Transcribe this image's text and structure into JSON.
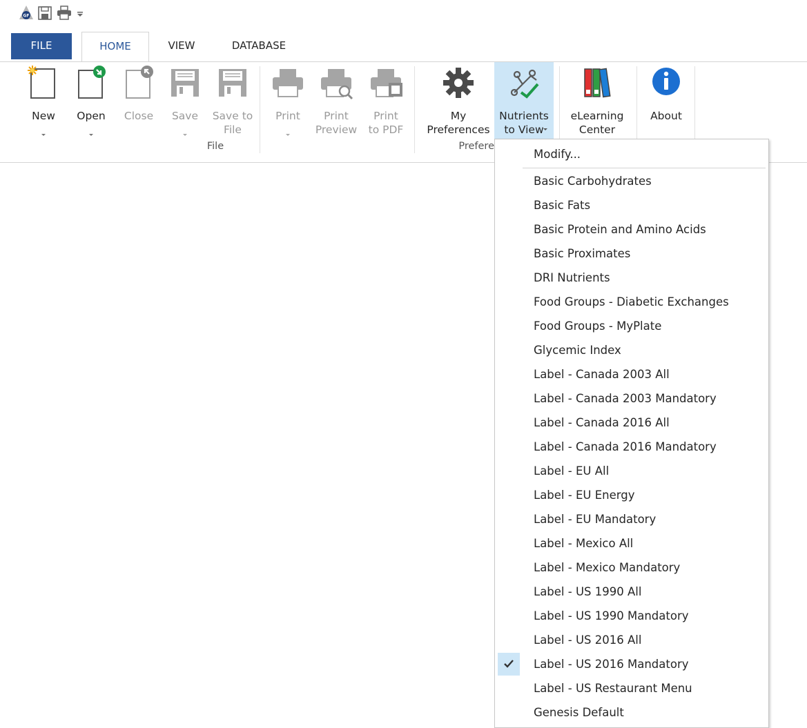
{
  "colors": {
    "accent": "#2b579a",
    "hover_highlight": "#cde6f7",
    "disabled_text": "#9a9a9a"
  },
  "quick_access": {
    "icons": [
      "genesis-logo-icon",
      "save-icon",
      "print-icon",
      "customize-dropdown-icon"
    ],
    "logo_text": "GF"
  },
  "tabs": [
    {
      "label": "FILE"
    },
    {
      "label": "HOME"
    },
    {
      "label": "VIEW"
    },
    {
      "label": "DATABASE"
    }
  ],
  "ribbon": {
    "file_group": {
      "label": "File",
      "buttons": {
        "new": "New",
        "open": "Open",
        "close": "Close",
        "save": "Save",
        "save_to_file": "Save to\nFile",
        "print": "Print",
        "print_preview": "Print\nPreview",
        "print_pdf": "Print\nto PDF"
      }
    },
    "preferences_group": {
      "label": "Prefere",
      "buttons": {
        "my_preferences": "My\nPreferences",
        "nutrients_to_view": "Nutrients\nto View"
      }
    },
    "other_buttons": {
      "elearning": "eLearning\nCenter",
      "about": "About"
    }
  },
  "menu": {
    "items": [
      {
        "label": "Modify...",
        "checked": false
      },
      {
        "label": "Basic Carbohydrates",
        "checked": false
      },
      {
        "label": "Basic Fats",
        "checked": false
      },
      {
        "label": "Basic Protein and Amino Acids",
        "checked": false
      },
      {
        "label": "Basic Proximates",
        "checked": false
      },
      {
        "label": "DRI Nutrients",
        "checked": false
      },
      {
        "label": "Food Groups - Diabetic Exchanges",
        "checked": false
      },
      {
        "label": "Food Groups - MyPlate",
        "checked": false
      },
      {
        "label": "Glycemic Index",
        "checked": false
      },
      {
        "label": "Label - Canada 2003 All",
        "checked": false
      },
      {
        "label": "Label - Canada 2003 Mandatory",
        "checked": false
      },
      {
        "label": "Label - Canada 2016 All",
        "checked": false
      },
      {
        "label": "Label - Canada 2016 Mandatory",
        "checked": false
      },
      {
        "label": "Label - EU All",
        "checked": false
      },
      {
        "label": "Label - EU Energy",
        "checked": false
      },
      {
        "label": "Label - EU Mandatory",
        "checked": false
      },
      {
        "label": "Label - Mexico All",
        "checked": false
      },
      {
        "label": "Label - Mexico Mandatory",
        "checked": false
      },
      {
        "label": "Label - US 1990 All",
        "checked": false
      },
      {
        "label": "Label - US 1990 Mandatory",
        "checked": false
      },
      {
        "label": "Label - US 2016 All",
        "checked": false
      },
      {
        "label": "Label - US 2016 Mandatory",
        "checked": true
      },
      {
        "label": "Label - US Restaurant Menu",
        "checked": false
      },
      {
        "label": "Genesis Default",
        "checked": false
      }
    ]
  }
}
